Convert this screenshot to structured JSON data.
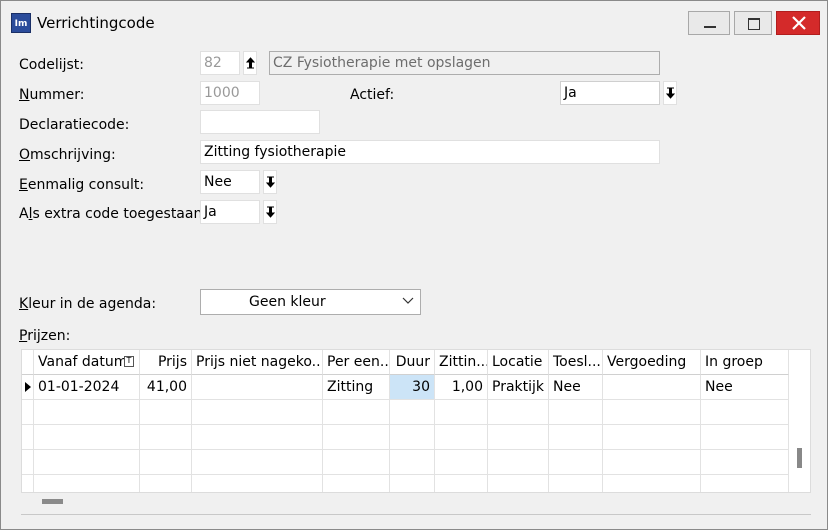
{
  "window": {
    "title": "Verrichtingcode",
    "app_icon_text": "Im"
  },
  "form": {
    "codelijst_label": "Codelijst:",
    "codelijst_value": "82",
    "codelijst_name": "CZ Fysiotherapie met opslagen",
    "nummer_label": "Nummer:",
    "nummer_value": "1000",
    "actief_label": "Actief:",
    "actief_value": "Ja",
    "declaratiecode_label": "Declaratiecode:",
    "declaratiecode_value": "",
    "omschrijving_label": "Omschrijving:",
    "omschrijving_value": "Zitting fysiotherapie",
    "eenmalig_label": "Eenmalig consult:",
    "eenmalig_value": "Nee",
    "extra_label": "Als extra code toegestaan:",
    "extra_value": "Ja",
    "kleur_label": "Kleur in de agenda:",
    "kleur_value": "Geen kleur",
    "prijzen_label": "Prijzen:"
  },
  "grid": {
    "columns": [
      "Vanaf datum",
      "Prijs",
      "Prijs niet nageko...",
      "Per een...",
      "Duur",
      "Zittin...",
      "Locatie",
      "Toesl...",
      "Vergoeding",
      "In groep"
    ],
    "rows": [
      [
        "01-01-2024",
        "41,00",
        "",
        "Zitting",
        "30",
        "1,00",
        "Praktijk",
        "Nee",
        "",
        "Nee"
      ]
    ]
  },
  "icons": {
    "sort_icon": "filter-sort-icon",
    "row_indicator": "row-pointer-icon",
    "spin": "arrow-down-icon"
  }
}
